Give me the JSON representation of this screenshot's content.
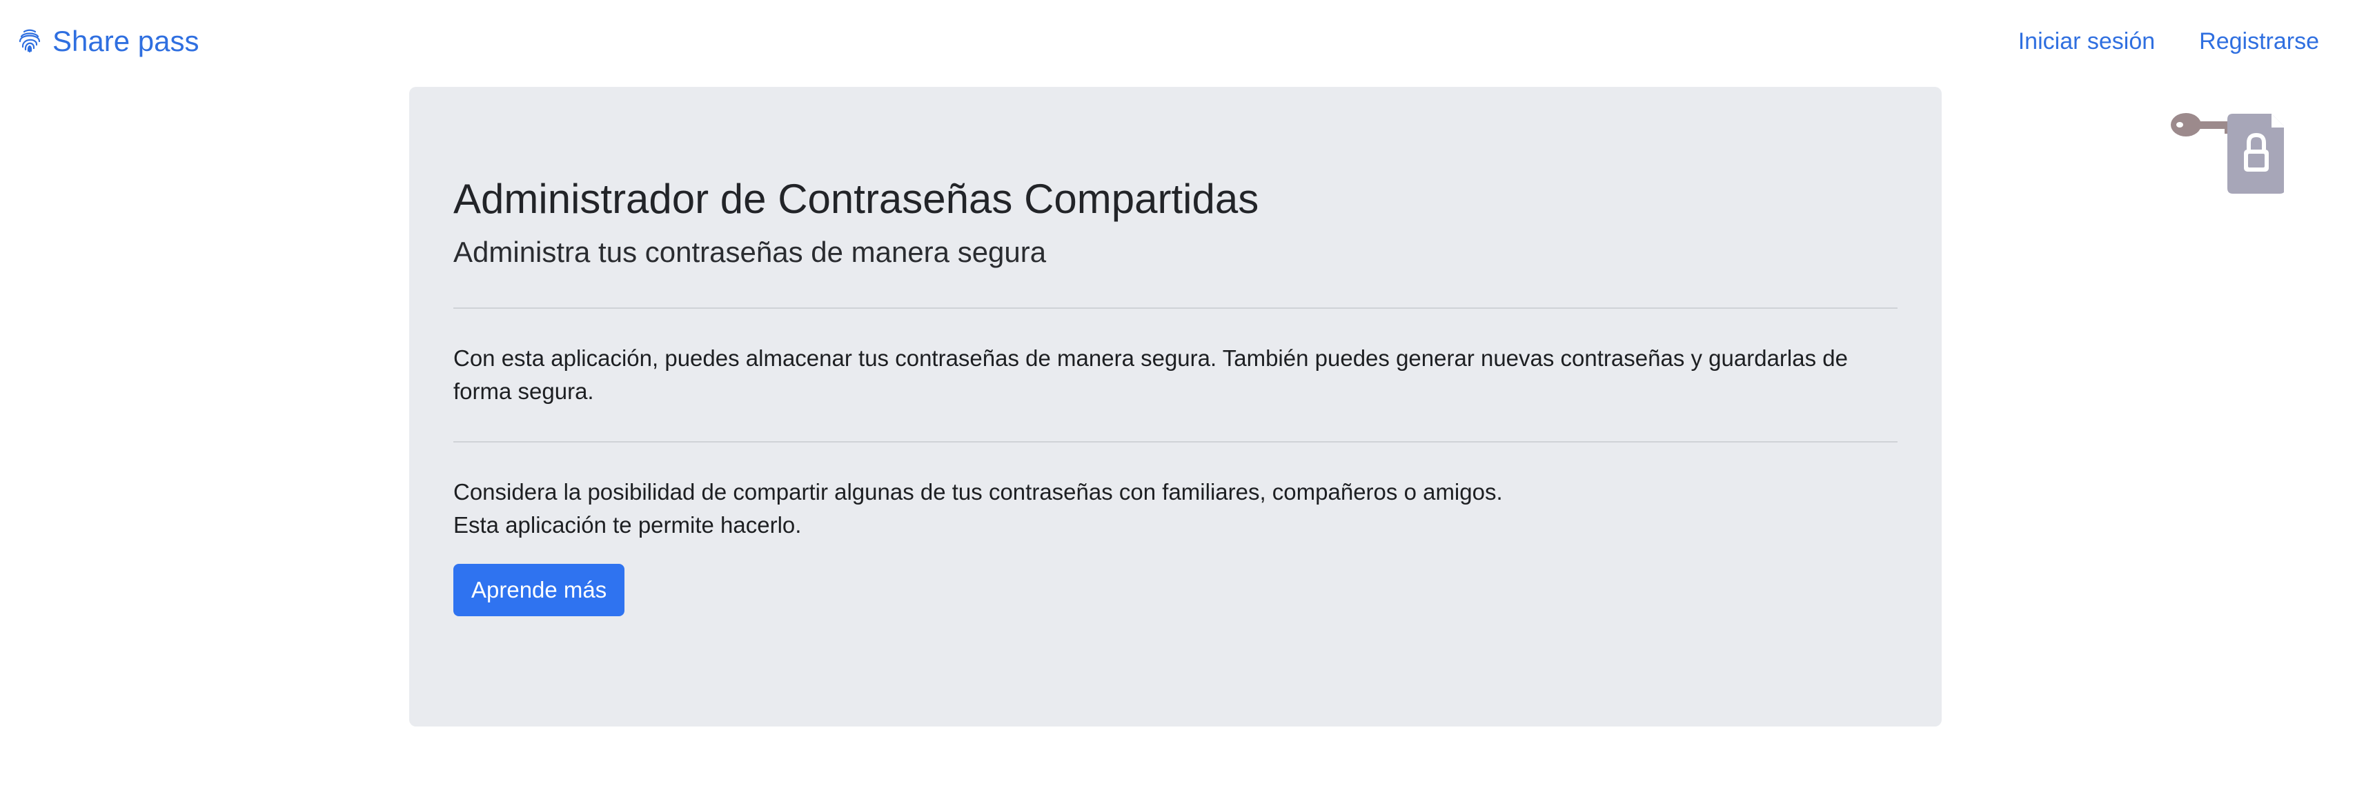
{
  "navbar": {
    "brand_label": "Share pass",
    "brand_icon": "fingerprint-icon",
    "links": [
      {
        "label": "Iniciar sesión"
      },
      {
        "label": "Registrarse"
      }
    ]
  },
  "illustration": {
    "icons": [
      "key-icon",
      "locked-file-icon"
    ]
  },
  "jumbotron": {
    "title": "Administrador de Contraseñas Compartidas",
    "subtitle": "Administra tus contraseñas de manera segura",
    "paragraph_1": "Con esta aplicación, puedes almacenar tus contraseñas de manera segura. También puedes generar nuevas contraseñas y guardarlas de forma segura.",
    "paragraph_2_line_1": "Considera la posibilidad de compartir algunas de tus contraseñas con familiares, compañeros o amigos.",
    "paragraph_2_line_2": "Esta aplicación te permite hacerlo.",
    "button_label": "Aprende más"
  },
  "colors": {
    "link": "#2f6fe0",
    "primary_button": "#2f73f0",
    "card_background": "#e9ebef",
    "key": "#9c8a8c",
    "file": "#a7a6b8"
  }
}
